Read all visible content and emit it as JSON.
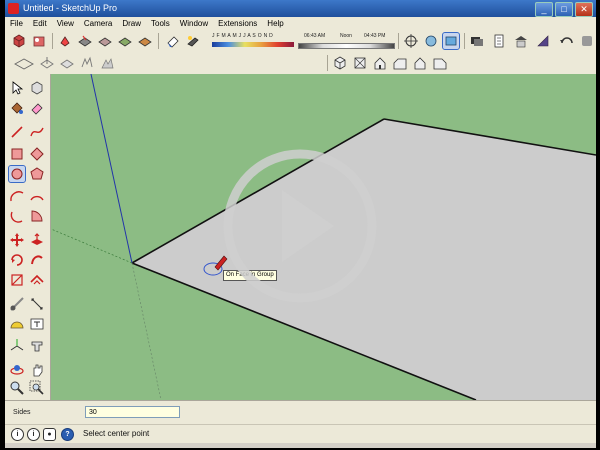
{
  "window": {
    "title": "Untitled - SketchUp Pro"
  },
  "menu": [
    "File",
    "Edit",
    "View",
    "Camera",
    "Draw",
    "Tools",
    "Window",
    "Extensions",
    "Help"
  ],
  "shadow": {
    "months": "J F M A M J J A S O N D",
    "time_start": "06:43 AM",
    "time_mid": "Noon",
    "time_end": "04:43 PM"
  },
  "toolbar_icons": [
    "cube-icon",
    "orbit-icon",
    "paint-icon",
    "pan-icon",
    "zoom-icon",
    "zoom-extents-icon",
    "eraser-icon",
    "section-icon",
    "shadow-icon",
    "fog-icon",
    "camera-icon",
    "view-icon",
    "model-info-icon",
    "components-icon"
  ],
  "views_icons": [
    "iso-view-icon",
    "top-view-icon",
    "front-view-icon",
    "right-view-icon",
    "back-view-icon",
    "left-view-icon"
  ],
  "sidebar_tools": [
    "select-icon",
    "make-component-icon",
    "paint-bucket-icon",
    "eraser-icon",
    "line-icon",
    "freehand-icon",
    "rectangle-icon",
    "rotated-rectangle-icon",
    "circle-icon",
    "polygon-icon",
    "arc-icon",
    "pie-icon",
    "move-icon",
    "push-pull-icon",
    "rotate-icon",
    "follow-me-icon",
    "scale-icon",
    "offset-icon",
    "tape-measure-icon",
    "text-icon",
    "axes-icon",
    "dimension-icon",
    "orbit-icon",
    "pan-icon",
    "zoom-icon",
    "zoom-window-icon"
  ],
  "viewport": {
    "tooltip": "On Face in Group"
  },
  "vcb": {
    "label": "Sides",
    "value": "30"
  },
  "status": {
    "text": "Select center point",
    "icons": [
      "i",
      "i",
      "?"
    ]
  },
  "colors": {
    "viewport_bg": "#8cbc84",
    "face": "#cccccc",
    "accent": "#3a6bc7"
  }
}
